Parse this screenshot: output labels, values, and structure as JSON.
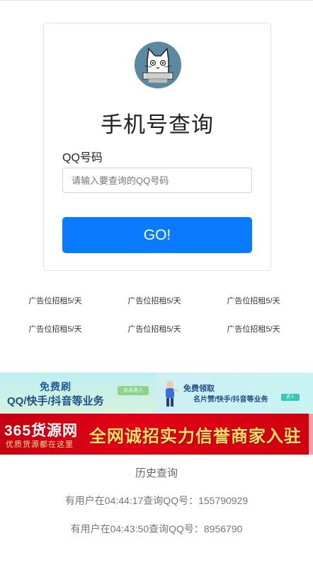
{
  "form": {
    "title": "手机号查询",
    "label": "QQ号码",
    "placeholder": "请输入要查询的QQ号码",
    "button": "GO!"
  },
  "ads": [
    [
      "广告位招租5/天",
      "广告位招租5/天",
      "广告位招租5/天"
    ],
    [
      "广告位招租5/天",
      "广告位招租5/天",
      "广告位招租5/天"
    ]
  ],
  "banners": {
    "top_left_line1": "免费刷",
    "top_left_line2": "QQ/快手/抖音等业务",
    "top_left_button": "点击进入",
    "top_right_line1": "免费领取",
    "top_right_line2": "名片赞/快手/抖音等业务",
    "top_right_tag": "进入",
    "bottom_brand": "365货源网",
    "bottom_slogan": "优质货源都在这里",
    "bottom_main": "全网诚招实力信誉商家入驻"
  },
  "history": {
    "title": "历史查询",
    "entries": [
      "有用户在04:44:17查询QQ号：155790929",
      "有用户在04:43:50查询QQ号：8956790"
    ]
  },
  "colors": {
    "button": "#0a7bff",
    "banner_red": "#e10016",
    "banner_teal": "#c8f3f3"
  }
}
